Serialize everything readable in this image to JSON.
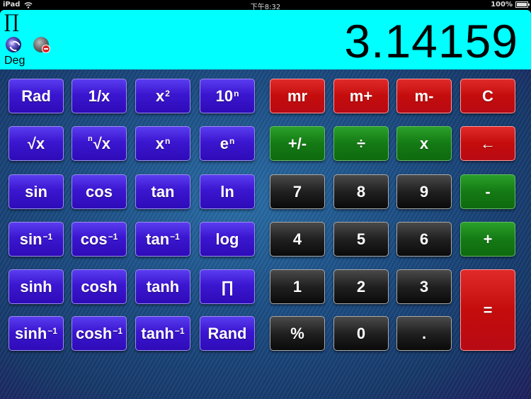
{
  "statusbar": {
    "device": "iPad",
    "time": "下午8:32",
    "battery": "100%",
    "battery_level": 1.0
  },
  "display": {
    "memory_indicator": "∏",
    "angle_mode": "Deg",
    "value": "3.14159",
    "icons": [
      "swirl-app-icon",
      "mute-sound-icon"
    ]
  },
  "keys": {
    "rad": "Rad",
    "reciprocal": "1/x",
    "square_base": "x",
    "square_sup": "2",
    "pow10_base": "10",
    "pow10_sup": "n",
    "sqrt": "√x",
    "nroot_pre": "n",
    "nroot_base": "√x",
    "pow_base": "x",
    "pow_sup": "n",
    "exp_base": "e",
    "exp_sup": "n",
    "sin": "sin",
    "cos": "cos",
    "tan": "tan",
    "ln": "ln",
    "asin_base": "sin",
    "asin_sup": "−1",
    "acos_base": "cos",
    "acos_sup": "−1",
    "atan_base": "tan",
    "atan_sup": "−1",
    "log": "log",
    "sinh": "sinh",
    "cosh": "cosh",
    "tanh": "tanh",
    "pi": "∏",
    "asinh_base": "sinh",
    "asinh_sup": "−1",
    "acosh_base": "cosh",
    "acosh_sup": "−1",
    "atanh_base": "tanh",
    "atanh_sup": "−1",
    "rand": "Rand",
    "mr": "mr",
    "mplus": "m+",
    "mminus": "m-",
    "clear": "C",
    "negate": "+/-",
    "divide": "÷",
    "multiply": "x",
    "backspace": "←",
    "d7": "7",
    "d8": "8",
    "d9": "9",
    "minus": "-",
    "d4": "4",
    "d5": "5",
    "d6": "6",
    "plus": "+",
    "d1": "1",
    "d2": "2",
    "d3": "3",
    "equals": "=",
    "percent": "%",
    "d0": "0",
    "decimal": "."
  },
  "colors": {
    "display_bg": "#00ffff",
    "function_key": "#3b16d0",
    "memory_key": "#c40c0c",
    "operator_key": "#147a14",
    "digit_key": "#202020"
  }
}
